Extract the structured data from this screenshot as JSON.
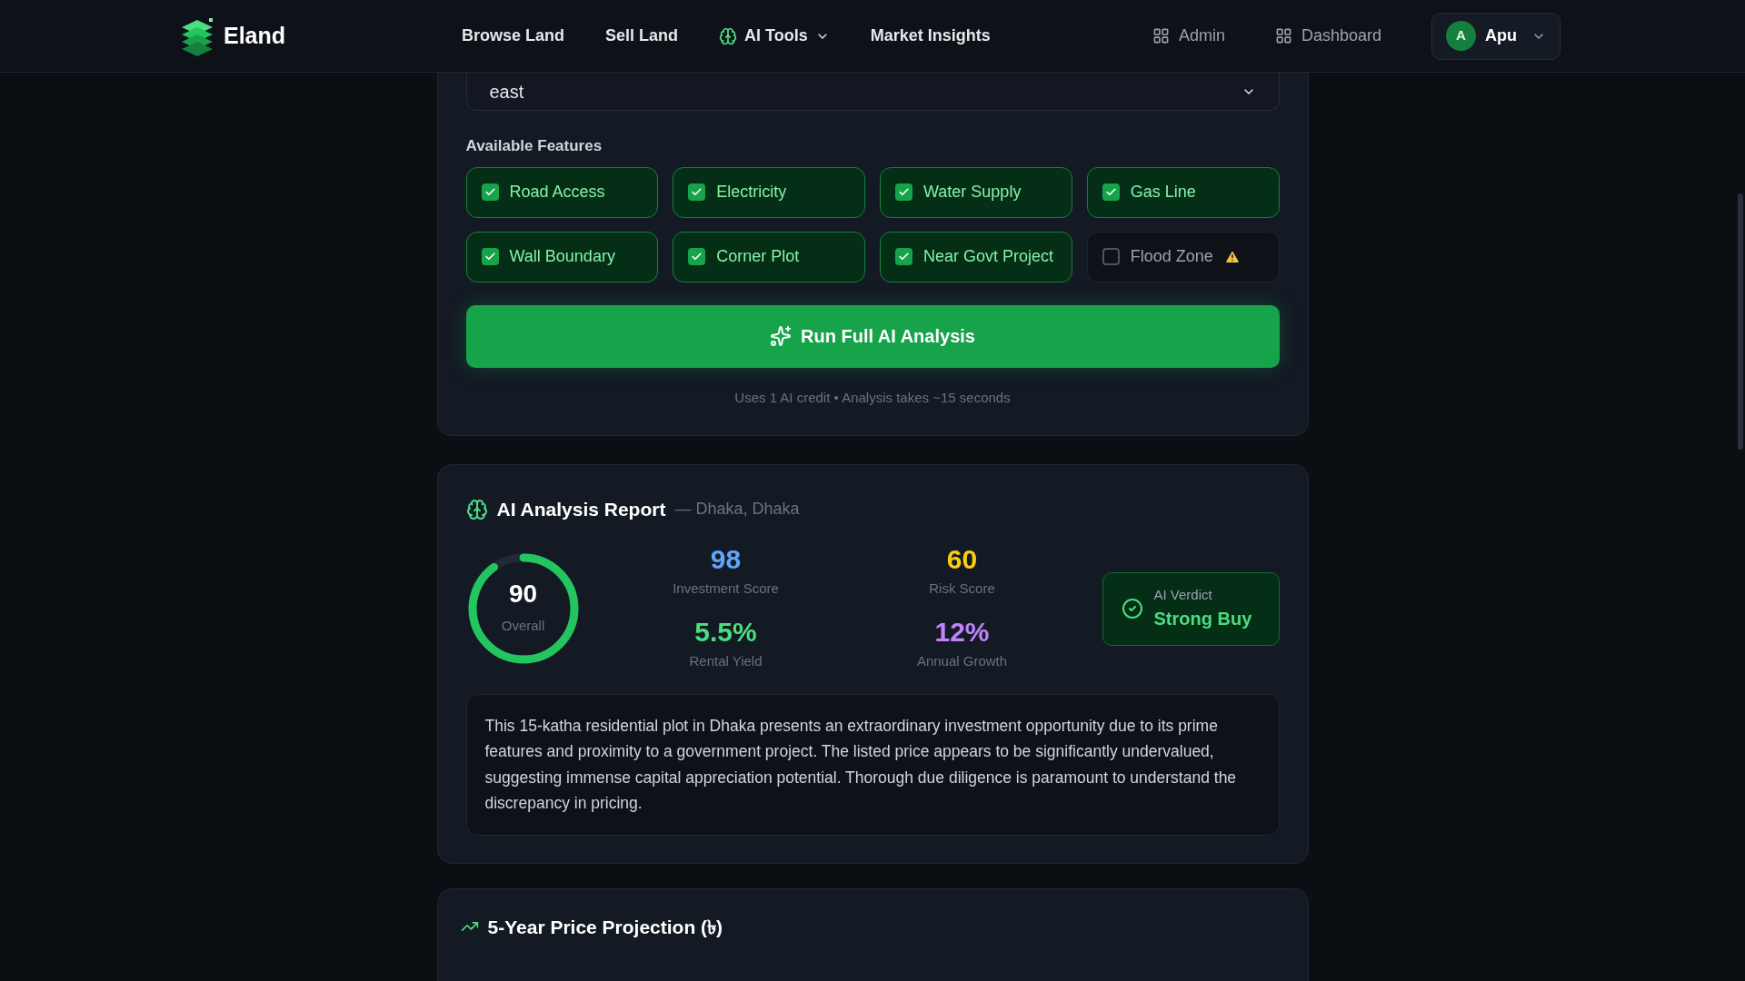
{
  "header": {
    "brand": "Eland",
    "nav": [
      {
        "label": "Browse Land",
        "kind": "link"
      },
      {
        "label": "Sell Land",
        "kind": "link"
      },
      {
        "label": "AI Tools",
        "kind": "menu"
      },
      {
        "label": "Market Insights",
        "kind": "link"
      }
    ],
    "actions": [
      {
        "label": "Admin"
      },
      {
        "label": "Dashboard"
      }
    ],
    "user": {
      "initial": "A",
      "name": "Apu"
    }
  },
  "form": {
    "facing": {
      "value": "east"
    },
    "features_label": "Available Features",
    "features": [
      {
        "label": "Road Access",
        "checked": true,
        "warning": false
      },
      {
        "label": "Electricity",
        "checked": true,
        "warning": false
      },
      {
        "label": "Water Supply",
        "checked": true,
        "warning": false
      },
      {
        "label": "Gas Line",
        "checked": true,
        "warning": false
      },
      {
        "label": "Wall Boundary",
        "checked": true,
        "warning": false
      },
      {
        "label": "Corner Plot",
        "checked": true,
        "warning": false
      },
      {
        "label": "Near Govt Project",
        "checked": true,
        "warning": false
      },
      {
        "label": "Flood Zone",
        "checked": false,
        "warning": true
      }
    ],
    "run_button": "Run Full AI Analysis",
    "note": "Uses 1 AI credit • Analysis takes ~15 seconds"
  },
  "report": {
    "title": "AI Analysis Report",
    "location": "— Dhaka, Dhaka",
    "overall": {
      "value": "90",
      "label": "Overall",
      "level": 0.9
    },
    "metrics": [
      {
        "value": "98",
        "label": "Investment Score",
        "color": "#60a5fa"
      },
      {
        "value": "60",
        "label": "Risk Score",
        "color": "#facc15"
      },
      {
        "value": "5.5%",
        "label": "Rental Yield",
        "color": "#4ade80"
      },
      {
        "value": "12%",
        "label": "Annual Growth",
        "color": "#c084fc"
      }
    ],
    "verdict": {
      "label": "AI Verdict",
      "value": "Strong Buy"
    },
    "summary": "This 15-katha residential plot in Dhaka presents an extraordinary investment opportunity due to its prime features and proximity to a government project. The listed price appears to be significantly undervalued, suggesting immense capital appreciation potential. Thorough due diligence is paramount to understand the discrepancy in pricing."
  },
  "projection": {
    "title": "5-Year Price Projection (৳)"
  }
}
